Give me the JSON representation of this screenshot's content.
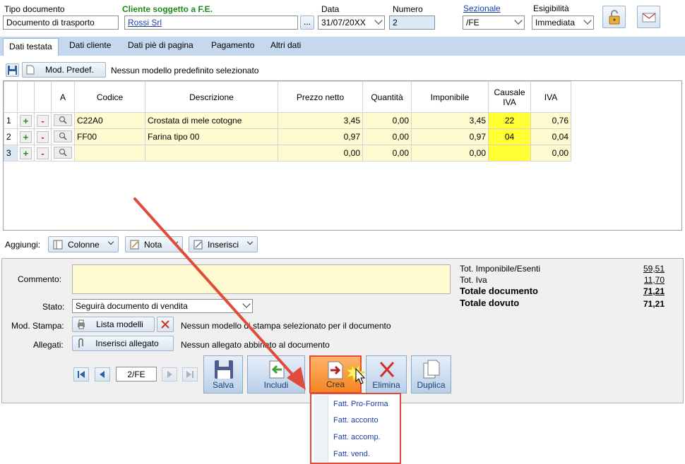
{
  "header": {
    "tipo_documento_label": "Tipo documento",
    "tipo_documento_value": "Documento di trasporto",
    "cliente_label": "Cliente soggetto a F.E.",
    "cliente_value": "Rossi Srl",
    "cliente_button": "...",
    "data_label": "Data",
    "data_value": "31/07/20XX",
    "numero_label": "Numero",
    "numero_value": "2",
    "sezionale_label": "Sezionale",
    "sezionale_value": "/FE",
    "esigibilita_label": "Esigibilità",
    "esigibilita_value": "Immediata"
  },
  "tabs": [
    "Dati testata",
    "Dati cliente",
    "Dati piè di pagina",
    "Pagamento",
    "Altri dati"
  ],
  "toolbar": {
    "mod_predef_label": "Mod. Predef.",
    "mod_predef_status": "Nessun modello predefinito selezionato"
  },
  "grid": {
    "columns": [
      "A",
      "Codice",
      "Descrizione",
      "Prezzo netto",
      "Quantità",
      "Imponibile",
      "Causale IVA",
      "IVA"
    ],
    "rows": [
      {
        "n": "1",
        "codice": "C22A0",
        "descrizione": "Crostata di mele cotogne",
        "prezzo": "3,45",
        "quantita": "0,00",
        "imponibile": "3,45",
        "causale": "22",
        "iva": "0,76"
      },
      {
        "n": "2",
        "codice": "FF00",
        "descrizione": "Farina tipo 00",
        "prezzo": "0,97",
        "quantita": "0,00",
        "imponibile": "0,97",
        "causale": "04",
        "iva": "0,04"
      },
      {
        "n": "3",
        "codice": "",
        "descrizione": "",
        "prezzo": "0,00",
        "quantita": "0,00",
        "imponibile": "0,00",
        "causale": "",
        "iva": "0,00"
      }
    ]
  },
  "aggiungi": {
    "label": "Aggiungi:",
    "colonne": "Colonne",
    "nota": "Nota",
    "inserisci": "Inserisci"
  },
  "footer": {
    "commento_label": "Commento:",
    "stato_label": "Stato:",
    "stato_value": "Seguirà documento di vendita",
    "mod_stampa_label": "Mod. Stampa:",
    "lista_modelli": "Lista modelli",
    "mod_stampa_status": "Nessun modello di stampa selezionato per il documento",
    "allegati_label": "Allegati:",
    "inserisci_allegato": "Inserisci allegato",
    "allegati_status": "Nessun allegato abbinato al documento",
    "record_nav": "2/FE"
  },
  "totals": {
    "imponibile_label": "Tot. Imponibile/Esenti",
    "imponibile_value": "59,51",
    "iva_label": "Tot. Iva",
    "iva_value": "11,70",
    "documento_label": "Totale documento",
    "documento_value": "71,21",
    "dovuto_label": "Totale dovuto",
    "dovuto_value": "71,21"
  },
  "actions": {
    "salva": "Salva",
    "includi": "Includi",
    "crea": "Crea",
    "elimina": "Elimina",
    "duplica": "Duplica"
  },
  "crea_menu": [
    "Fatt. Pro-Forma",
    "Fatt. acconto",
    "Fatt. accomp.",
    "Fatt. vend."
  ],
  "colors": {
    "accent_blue": "#c6d8ee",
    "highlight_yellow": "#ffff33",
    "row_yellow": "#fffbd1",
    "annotation_red": "#e04b3c",
    "crea_orange": "#f5841f"
  }
}
